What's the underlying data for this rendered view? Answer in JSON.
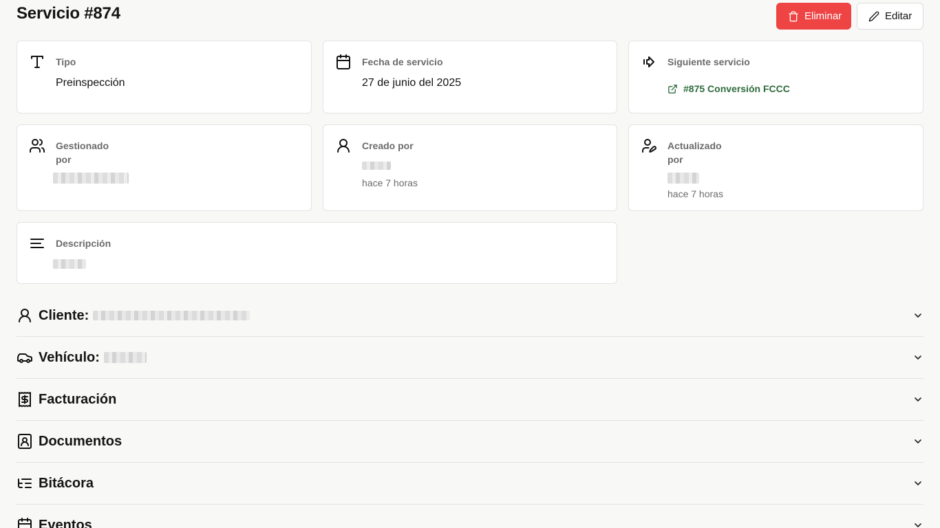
{
  "header": {
    "title": "Servicio #874",
    "delete_label": "Eliminar",
    "edit_label": "Editar",
    "delete_color": "#ef4444"
  },
  "cards": {
    "tipo": {
      "label": "Tipo",
      "value": "Preinspección",
      "icon": "type-icon"
    },
    "fecha": {
      "label": "Fecha de servicio",
      "value": "27 de junio del 2025",
      "icon": "calendar-icon"
    },
    "siguiente": {
      "label": "Siguiente servicio",
      "link_text": "#875 Conversión FCCC",
      "icon": "arrow-right-to-line-icon",
      "link_color": "#2f6b3c"
    },
    "gestionado": {
      "label": "Gestionado por",
      "icon": "users-icon"
    },
    "creado": {
      "label": "Creado por",
      "time": "hace 7 horas",
      "icon": "user-icon"
    },
    "actualizado": {
      "label": "Actualizado por",
      "time": "hace 7 horas",
      "icon": "user-pen-icon"
    },
    "descripcion": {
      "label": "Descripción",
      "icon": "text-align-left-icon"
    }
  },
  "sections": [
    {
      "title": "Cliente:",
      "icon": "user-icon"
    },
    {
      "title": "Vehículo:",
      "icon": "car-icon"
    },
    {
      "title": "Facturación",
      "icon": "receipt-dollar-icon"
    },
    {
      "title": "Documentos",
      "icon": "contact-card-icon"
    },
    {
      "title": "Bitácora",
      "icon": "list-tree-icon"
    },
    {
      "title": "Eventos",
      "icon": "calendar-icon"
    }
  ]
}
